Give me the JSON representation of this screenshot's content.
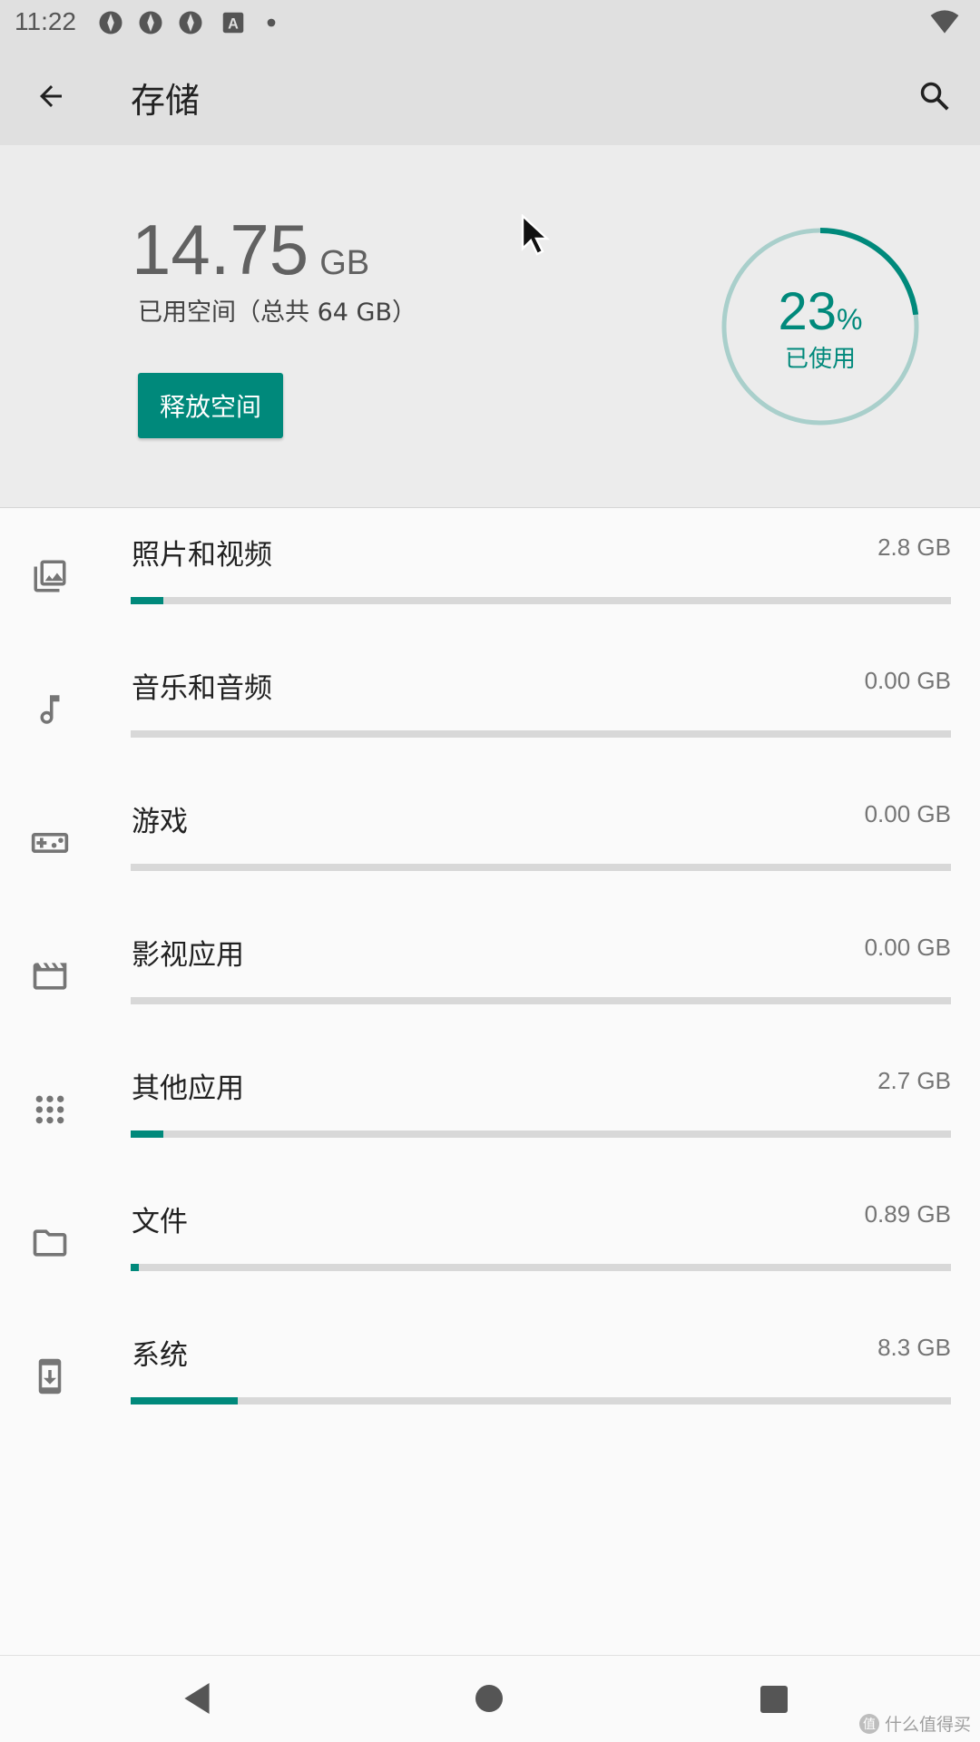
{
  "status_bar": {
    "time": "11:22",
    "icons": [
      "aperture-icon",
      "aperture-icon",
      "aperture-icon",
      "a-box-icon",
      "dot-icon"
    ],
    "right_icon": "wifi-icon"
  },
  "app_bar": {
    "back_icon": "arrow-back-icon",
    "title": "存储",
    "search_icon": "search-icon"
  },
  "summary": {
    "used_number": "14.75",
    "used_unit": "GB",
    "used_desc": "已用空间（总共 64 GB）",
    "free_button": "释放空间",
    "percent_number": "23",
    "percent_sign": "%",
    "percent_label": "已使用",
    "percent_value": 23,
    "accent_color": "#00897b"
  },
  "categories": [
    {
      "label": "照片和视频",
      "size": "2.8 GB",
      "icon": "photo-library-icon",
      "fill": 0.04
    },
    {
      "label": "音乐和音频",
      "size": "0.00 GB",
      "icon": "music-note-icon",
      "fill": 0
    },
    {
      "label": "游戏",
      "size": "0.00 GB",
      "icon": "gamepad-icon",
      "fill": 0
    },
    {
      "label": "影视应用",
      "size": "0.00 GB",
      "icon": "movie-icon",
      "fill": 0
    },
    {
      "label": "其他应用",
      "size": "2.7 GB",
      "icon": "apps-icon",
      "fill": 0.04
    },
    {
      "label": "文件",
      "size": "0.89 GB",
      "icon": "folder-icon",
      "fill": 0.01
    },
    {
      "label": "系统",
      "size": "8.3 GB",
      "icon": "system-update-icon",
      "fill": 0.13
    }
  ],
  "nav_bar": {
    "back": "nav-back-icon",
    "home": "nav-home-icon",
    "recent": "nav-recent-icon"
  },
  "watermark": {
    "icon_text": "值",
    "text": "什么值得买"
  }
}
